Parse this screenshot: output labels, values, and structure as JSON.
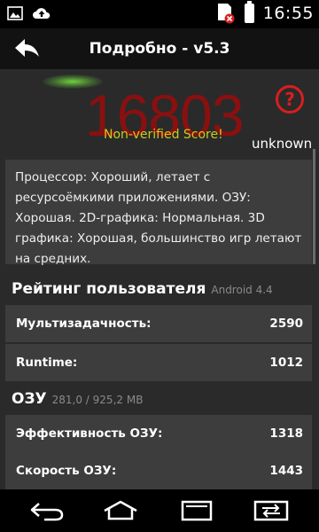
{
  "status_bar": {
    "time": "16:55",
    "icons": [
      "image-icon",
      "cloud-upload-icon",
      "sim-error-icon",
      "battery-icon"
    ]
  },
  "header": {
    "title": "Подробно - v5.3",
    "back_icon": "back-arrow-icon"
  },
  "score": {
    "value": "16803",
    "notice": "Non-verified Score!",
    "device": "unknown",
    "help_icon": "help-icon"
  },
  "description": "Процессор: Хороший, летает с ресурсоёмкими приложениями. ОЗУ: Хорошая. 2D-графика: Нормальная. 3D графика: Хорошая, большинство игр летают на средних.",
  "user_rating": {
    "title": "Рейтинг пользователя",
    "subtitle": "Android 4.4",
    "rows": [
      {
        "label": "Мультизадачность:",
        "value": "2590"
      },
      {
        "label": "Runtime:",
        "value": "1012"
      }
    ]
  },
  "ram": {
    "title": "ОЗУ",
    "subtitle": "281,0 / 925,2 MB",
    "rows": [
      {
        "label": "Эффективность ОЗУ:",
        "value": "1318"
      },
      {
        "label": "Скорость ОЗУ:",
        "value": "1443"
      }
    ]
  },
  "nav_bar": {
    "buttons": [
      "back-icon",
      "home-icon",
      "recents-icon",
      "switch-icon"
    ]
  },
  "colors": {
    "background": "#2a2a2a",
    "card": "#3d3d3d",
    "score": "#8a1010",
    "notice": "#c9cc1f",
    "help": "#d81e1e"
  }
}
